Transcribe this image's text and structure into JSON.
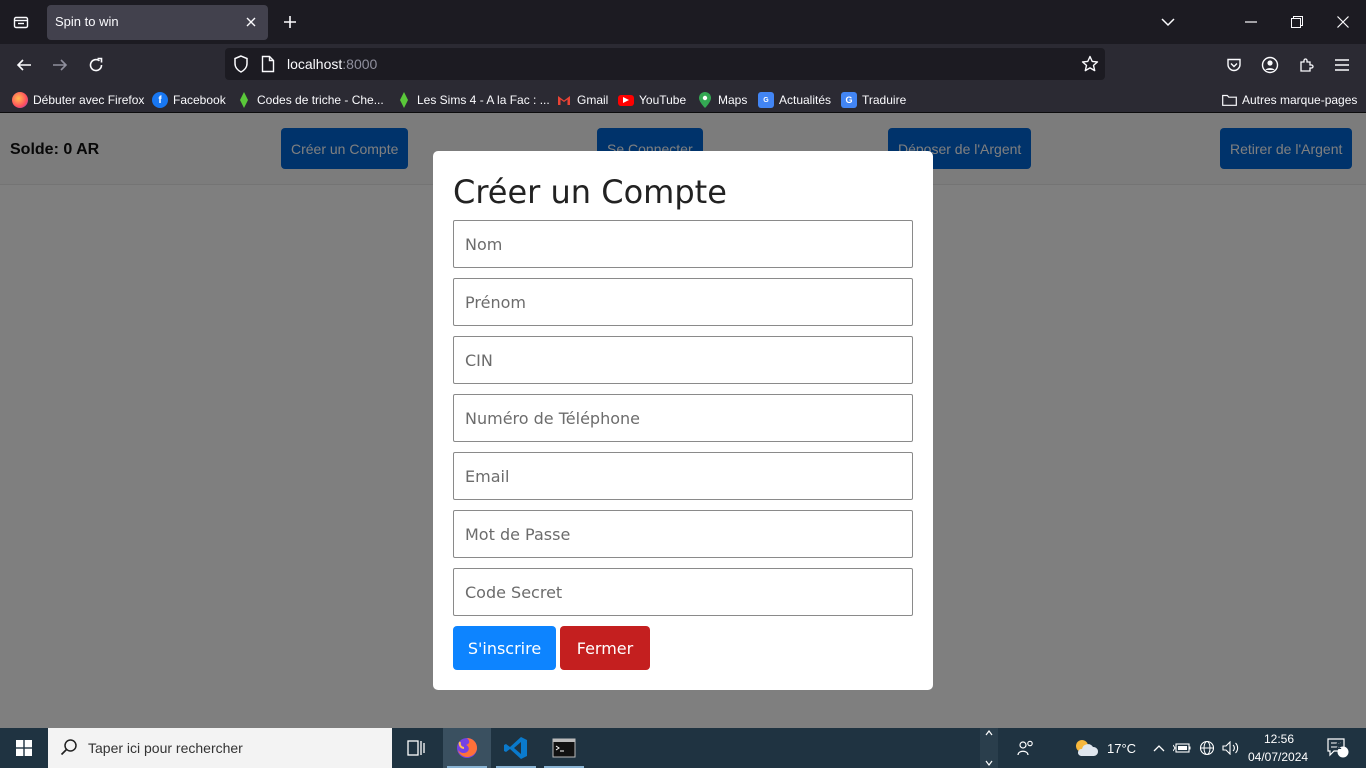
{
  "browser": {
    "tab_title": "Spin to win",
    "url_host": "localhost",
    "url_port": ":8000",
    "bookmarks": [
      {
        "label": "Débuter avec Firefox",
        "icon": "firefox-icon"
      },
      {
        "label": "Facebook",
        "icon": "facebook-icon"
      },
      {
        "label": "Codes de triche - Che...",
        "icon": "plumbob-icon"
      },
      {
        "label": "Les Sims 4 - A la Fac : ...",
        "icon": "plumbob-icon"
      },
      {
        "label": "Gmail",
        "icon": "gmail-icon"
      },
      {
        "label": "YouTube",
        "icon": "youtube-icon"
      },
      {
        "label": "Maps",
        "icon": "maps-icon"
      },
      {
        "label": "Actualités",
        "icon": "news-icon"
      },
      {
        "label": "Traduire",
        "icon": "translate-icon"
      }
    ],
    "other_bookmarks": "Autres marque-pages"
  },
  "page": {
    "balance": "Solde: 0 AR",
    "buttons": {
      "create": "Créer un Compte",
      "login": "Se Connecter",
      "deposit": "Déposer de l'Argent",
      "withdraw": "Retirer de l'Argent"
    }
  },
  "modal": {
    "title": "Créer un Compte",
    "fields": {
      "nom": "Nom",
      "prenom": "Prénom",
      "cin": "CIN",
      "telephone": "Numéro de Téléphone",
      "email": "Email",
      "password": "Mot de Passe",
      "code": "Code Secret"
    },
    "submit": "S'inscrire",
    "close": "Fermer"
  },
  "taskbar": {
    "search_placeholder": "Taper ici pour rechercher",
    "temperature": "17°C",
    "time": "12:56",
    "date": "04/07/2024",
    "notifications": "2"
  },
  "colors": {
    "primary": "#0066d6",
    "modal_submit": "#0d84ff",
    "danger": "#c41f1f"
  }
}
